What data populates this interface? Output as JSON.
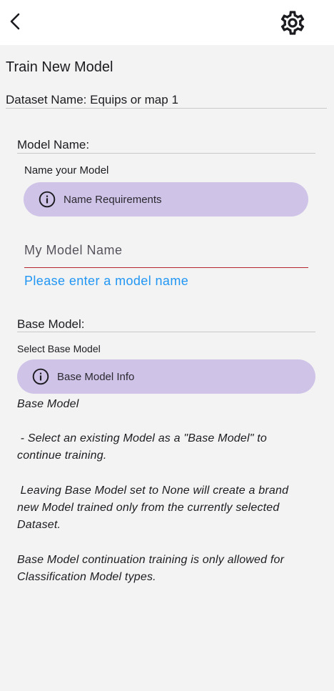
{
  "page": {
    "title": "Train New Model"
  },
  "dataset": {
    "name_label": "Dataset Name: Equips or map 1"
  },
  "model_name_section": {
    "title": "Model Name:",
    "sub_label": "Name your Model",
    "info_button_label": "Name Requirements",
    "input_placeholder": "My Model Name",
    "input_value": "",
    "error": "Please enter a model name"
  },
  "base_model_section": {
    "title": "Base Model:",
    "sub_label": "Select Base Model",
    "info_button_label": "Base Model Info",
    "description": [
      "Base Model",
      " - Select an existing Model as a \"Base Model\" to",
      "continue training.",
      " Leaving Base Model set to None will create a brand",
      "new Model trained only from the currently selected",
      "Dataset.",
      "Base Model continuation training is only allowed for",
      "Classification Model types."
    ]
  },
  "icons": {
    "back": "chevron-left-icon",
    "settings": "gear-icon",
    "info": "info-circle-icon"
  },
  "colors": {
    "pill_background": "#cfc3e8",
    "error_underline": "#b3262e",
    "error_text": "#2196f3",
    "page_background": "#f3f3f3"
  }
}
